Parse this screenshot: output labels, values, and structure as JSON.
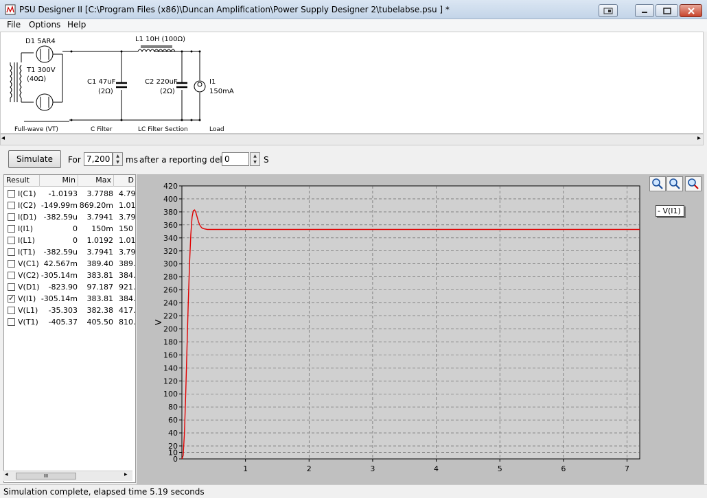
{
  "window": {
    "title": "PSU Designer II  [C:\\Program Files (x86)\\Duncan Amplification\\Power Supply Designer 2\\tubelabse.psu ] *",
    "icon": "app-icon"
  },
  "menu": [
    "File",
    "Options",
    "Help"
  ],
  "schematic": {
    "rectifier_label": "D1 5AR4",
    "transformer_label": "T1 300V",
    "transformer_res": "(40Ω)",
    "inductor_label": "L1 10H (100Ω)",
    "c1_label": "C1 47uF",
    "c1_res": "(2Ω)",
    "c2_label": "C2 220uF",
    "c2_res": "(2Ω)",
    "load_label": "I1",
    "load_value": "150mA",
    "sections": [
      "Full-wave (VT)",
      "C Filter",
      "LC Filter Section",
      "Load"
    ]
  },
  "controls": {
    "simulate_label": "Simulate",
    "for_label": "For",
    "duration_value": "7,200",
    "ms_label": "ms",
    "after_label": "after a reporting delay of",
    "delay_value": "0",
    "s_label": "S"
  },
  "results": {
    "headers": [
      "Result",
      "Min",
      "Max",
      "D"
    ],
    "rows": [
      {
        "name": "I(C1)",
        "min": "-1.0193",
        "max": "3.7788",
        "d": "4.79",
        "checked": false
      },
      {
        "name": "I(C2)",
        "min": "-149.99m",
        "max": "869.20m",
        "d": "1.01",
        "checked": false
      },
      {
        "name": "I(D1)",
        "min": "-382.59u",
        "max": "3.7941",
        "d": "3.79",
        "checked": false
      },
      {
        "name": "I(I1)",
        "min": "0",
        "max": "150m",
        "d": "150",
        "checked": false
      },
      {
        "name": "I(L1)",
        "min": "0",
        "max": "1.0192",
        "d": "1.01",
        "checked": false
      },
      {
        "name": "I(T1)",
        "min": "-382.59u",
        "max": "3.7941",
        "d": "3.79",
        "checked": false
      },
      {
        "name": "V(C1)",
        "min": "42.567m",
        "max": "389.40",
        "d": "389.",
        "checked": false
      },
      {
        "name": "V(C2)",
        "min": "-305.14m",
        "max": "383.81",
        "d": "384.",
        "checked": false
      },
      {
        "name": "V(D1)",
        "min": "-823.90",
        "max": "97.187",
        "d": "921.",
        "checked": false
      },
      {
        "name": "V(I1)",
        "min": "-305.14m",
        "max": "383.81",
        "d": "384.",
        "checked": true
      },
      {
        "name": "V(L1)",
        "min": "-35.303",
        "max": "382.38",
        "d": "417.",
        "checked": false
      },
      {
        "name": "V(T1)",
        "min": "-405.37",
        "max": "405.50",
        "d": "810.",
        "checked": false
      }
    ],
    "scroll_thumb": "III"
  },
  "chart_data": {
    "type": "line",
    "ylabel": "V",
    "xlabel": "",
    "ylim": [
      0,
      420
    ],
    "xlim": [
      0,
      7.2
    ],
    "yticks": [
      0,
      10,
      20,
      40,
      60,
      80,
      100,
      120,
      140,
      160,
      180,
      200,
      220,
      240,
      260,
      280,
      300,
      320,
      340,
      360,
      380,
      400,
      420
    ],
    "xticks": [
      1,
      2,
      3,
      4,
      5,
      6,
      7
    ],
    "grid": true,
    "legend": "top-right",
    "series": [
      {
        "name": "V(I1)",
        "color": "#e00000",
        "x": [
          0,
          0.02,
          0.04,
          0.06,
          0.08,
          0.1,
          0.12,
          0.14,
          0.16,
          0.18,
          0.2,
          0.22,
          0.24,
          0.26,
          0.28,
          0.3,
          0.32,
          0.35,
          0.4,
          0.45,
          0.5,
          0.6,
          0.8,
          1.0,
          2.0,
          3.0,
          4.0,
          5.0,
          6.0,
          7.0,
          7.2
        ],
        "y": [
          0,
          5,
          40,
          100,
          170,
          240,
          300,
          345,
          372,
          382,
          383,
          379,
          372,
          365,
          360,
          357,
          355,
          354,
          353,
          353,
          353,
          353,
          353,
          353,
          353,
          353,
          353,
          353,
          353,
          353,
          353
        ]
      }
    ]
  },
  "zoom_buttons": [
    "zoom-in-icon",
    "zoom-out-icon",
    "zoom-reset-icon"
  ],
  "status": "Simulation complete, elapsed time 5.19 seconds"
}
